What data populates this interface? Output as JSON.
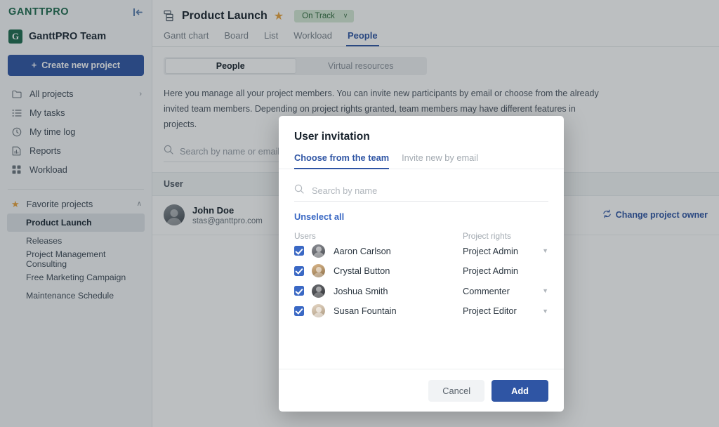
{
  "sidebar": {
    "logo_text": "GANTTPRO",
    "collapse_icon": "collapse-left-icon",
    "team": {
      "badge_letter": "G",
      "name": "GanttPRO Team"
    },
    "create_button": {
      "label": "Create new project",
      "icon": "plus-icon"
    },
    "nav": [
      {
        "label": "All projects",
        "icon": "folder-icon",
        "chevron": "›"
      },
      {
        "label": "My tasks",
        "icon": "list-icon"
      },
      {
        "label": "My time log",
        "icon": "clock-icon"
      },
      {
        "label": "Reports",
        "icon": "report-icon"
      },
      {
        "label": "Workload",
        "icon": "grid-icon"
      }
    ],
    "favorites": {
      "label": "Favorite projects",
      "star_icon": "star-icon",
      "chevron": "∧",
      "projects": [
        {
          "label": "Product Launch",
          "active": true
        },
        {
          "label": "Releases",
          "active": false
        },
        {
          "label": "Project Management Consulting",
          "active": false
        },
        {
          "label": "Free Marketing Campaign",
          "active": false
        },
        {
          "label": "Maintenance Schedule",
          "active": false
        }
      ]
    }
  },
  "header": {
    "project_icon": "gantt-layers-icon",
    "title": "Product Launch",
    "star_icon": "star-icon",
    "status": {
      "label": "On Track",
      "chevron": "∨",
      "color": "#d5e8d4"
    },
    "tabs": [
      {
        "label": "Gantt chart",
        "active": false
      },
      {
        "label": "Board",
        "active": false
      },
      {
        "label": "List",
        "active": false
      },
      {
        "label": "Workload",
        "active": false
      },
      {
        "label": "People",
        "active": true
      }
    ]
  },
  "main": {
    "segmented": [
      {
        "label": "People",
        "active": true
      },
      {
        "label": "Virtual resources",
        "active": false
      }
    ],
    "description": "Here you manage all your project members. You can invite new participants by email or choose from the already invited team members. Depending on project rights granted, team members may have different features in projects.",
    "search": {
      "placeholder": "Search by name or email",
      "icon": "search-icon",
      "value": ""
    },
    "table": {
      "columns": [
        "User"
      ],
      "rows": [
        {
          "name": "John Doe",
          "email": "stas@ganttpro.com",
          "avatar": "user-avatar",
          "action": {
            "label": "Change project owner",
            "icon": "refresh-icon"
          }
        }
      ]
    }
  },
  "modal": {
    "title": "User invitation",
    "tabs": [
      {
        "label": "Choose from the team",
        "active": true
      },
      {
        "label": "Invite new by email",
        "active": false
      }
    ],
    "search": {
      "placeholder": "Search by name",
      "icon": "search-icon",
      "value": ""
    },
    "unselect_all": "Unselect all",
    "columns": {
      "users": "Users",
      "rights": "Project rights"
    },
    "users": [
      {
        "name": "Aaron Carlson",
        "checked": true,
        "rights": "Project Admin",
        "has_dropdown": true,
        "av1": "#6f7075",
        "av2": "#3a3d42"
      },
      {
        "name": "Crystal Button",
        "checked": true,
        "rights": "Project Admin",
        "has_dropdown": false,
        "av1": "#c9a274",
        "av2": "#7e6242"
      },
      {
        "name": "Joshua Smith",
        "checked": true,
        "rights": "Commenter",
        "has_dropdown": true,
        "av1": "#57585c",
        "av2": "#2c2e31"
      },
      {
        "name": "Susan Fountain",
        "checked": true,
        "rights": "Project Editor",
        "has_dropdown": true,
        "av1": "#d8c8b4",
        "av2": "#a38f76"
      }
    ],
    "buttons": {
      "cancel": "Cancel",
      "add": "Add"
    }
  },
  "colors": {
    "accent": "#2f55a4",
    "link": "#3a68c4",
    "brand_green": "#1d6a4e",
    "star": "#e8a33d",
    "status_green_bg": "#d5e8d4"
  }
}
